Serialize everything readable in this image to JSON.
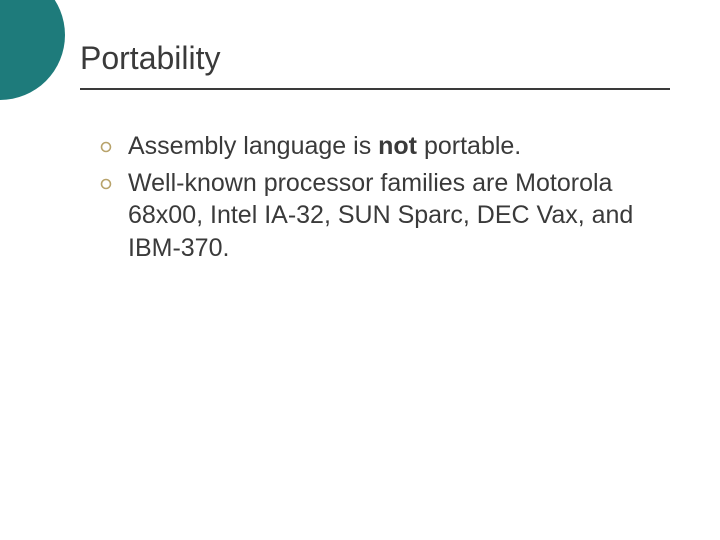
{
  "slide": {
    "title": "Portability",
    "bullets": [
      {
        "prefix": "Assembly language is ",
        "bold": "not",
        "suffix": " portable."
      },
      {
        "text": "Well-known processor families are Motorola 68x00, Intel IA-32, SUN Sparc, DEC Vax, and IBM-370."
      }
    ]
  },
  "colors": {
    "accent": "#1e7b7b",
    "bullet": "#b8a36b",
    "text": "#3a3a3a"
  }
}
